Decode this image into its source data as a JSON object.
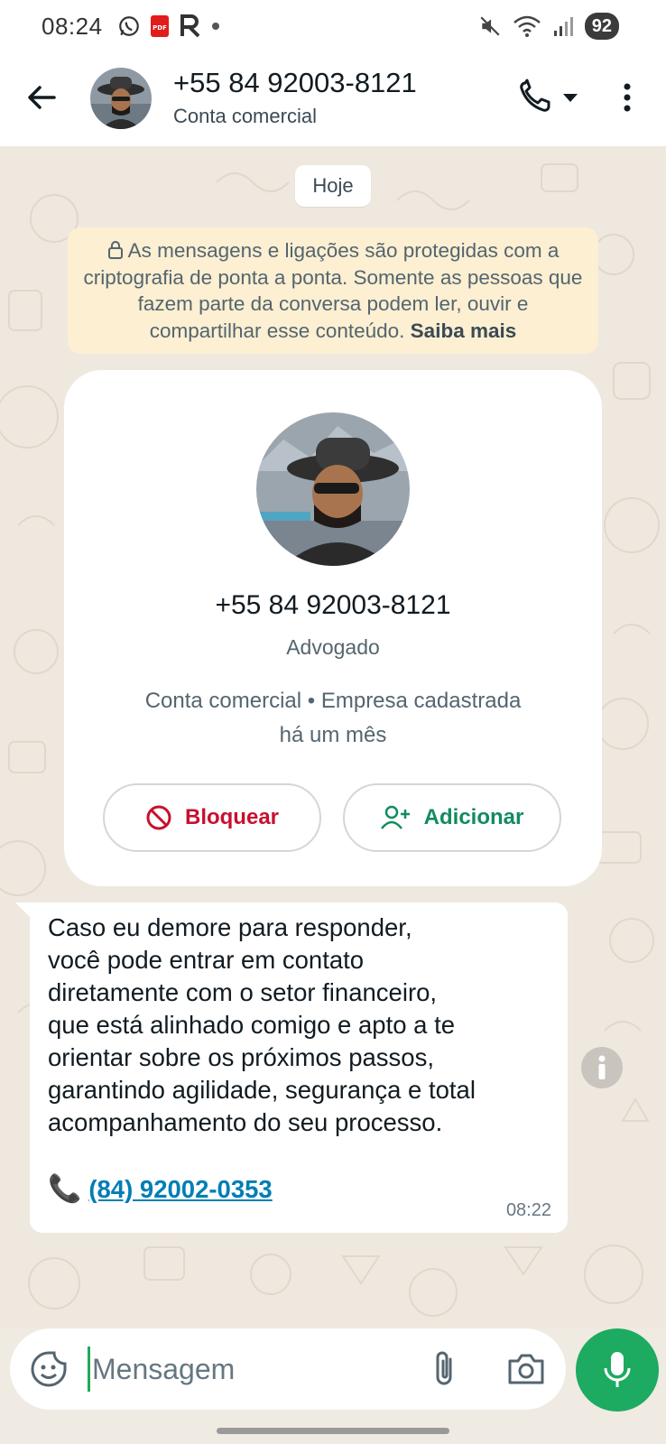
{
  "status_bar": {
    "time": "08:24",
    "battery": "92",
    "left_icons": [
      "whatsapp-icon",
      "pdf-icon",
      "r-app-icon",
      "dot-icon"
    ],
    "right_icons": [
      "mute-icon",
      "wifi-icon",
      "signal-icon"
    ]
  },
  "header": {
    "title": "+55 84 92003-8121",
    "subtitle": "Conta comercial",
    "icons": [
      "back-arrow-icon",
      "phone-icon",
      "caret-down-icon",
      "more-vert-icon"
    ]
  },
  "chat": {
    "date_chip": "Hoje",
    "encryption_notice": {
      "text": "As mensagens e ligações são protegidas com a criptografia de ponta a ponta. Somente as pessoas que fazem parte da conversa podem ler, ouvir e compartilhar esse conteúdo.",
      "link": "Saiba mais"
    },
    "business_card": {
      "phone": "+55 84 92003-8121",
      "role": "Advogado",
      "info_line1": "Conta comercial • Empresa cadastrada",
      "info_line2": "há um mês",
      "block_label": "Bloquear",
      "add_label": "Adicionar"
    },
    "message": {
      "text": "Caso eu demore para responder,\nvocê pode entrar em contato\ndiretamente com o setor financeiro,\nque está alinhado comigo e apto a te\norientar sobre os próximos passos,\ngarantindo agilidade, segurança e total\nacompanhamento do seu processo.",
      "emoji": "📞",
      "link": "(84) 92002-0353",
      "time": "08:22"
    }
  },
  "composer": {
    "placeholder": "Mensagem",
    "value": ""
  },
  "colors": {
    "accent_green": "#1daa61",
    "block_red": "#c8102e",
    "add_green": "#128c5e",
    "link_blue": "#027eb5",
    "encryption_bg": "#fcefd2",
    "chat_bg": "#efe8de"
  }
}
